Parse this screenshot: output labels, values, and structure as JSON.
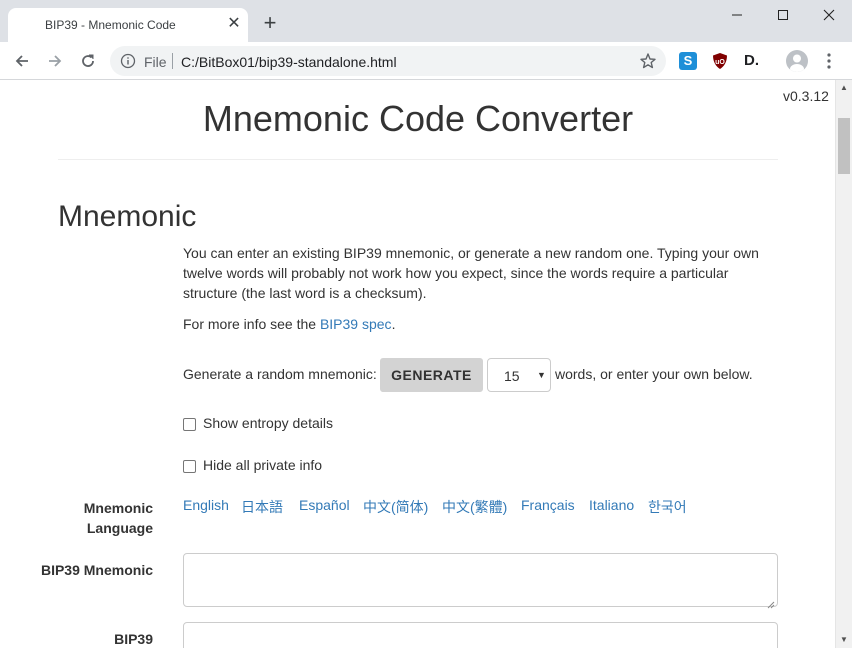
{
  "browser": {
    "tab_title": "BIP39 - Mnemonic Code",
    "omnibox_scheme": "File",
    "omnibox_url": "C:/BitBox01/bip39-standalone.html",
    "extensions": [
      "s-extension-icon",
      "ublock-icon",
      "d-extension-icon"
    ],
    "ext_s_label": "S",
    "ext_d_label": "D."
  },
  "page": {
    "version": "v0.3.12",
    "title": "Mnemonic Code Converter",
    "section_title": "Mnemonic",
    "intro_text": "You can enter an existing BIP39 mnemonic, or generate a new random one. Typing your own twelve words will probably not work how you expect, since the words require a particular structure (the last word is a checksum).",
    "moreinfo_prefix": "For more info see the ",
    "moreinfo_link": "BIP39 spec",
    "moreinfo_suffix": ".",
    "generate_label": "Generate a random mnemonic:",
    "generate_button": "GENERATE",
    "word_count_selected": "15",
    "generate_suffix": "words, or enter your own below.",
    "show_entropy_label": "Show entropy details",
    "hide_private_label": "Hide all private info",
    "language_label": "Mnemonic Language",
    "languages": [
      "English",
      "日本語",
      "Español",
      "中文(简体)",
      "中文(繁體)",
      "Français",
      "Italiano",
      "한국어"
    ],
    "bip39_mnemonic_label": "BIP39 Mnemonic",
    "bip39_mnemonic_value": "",
    "next_label": "BIP39"
  },
  "colors": {
    "link": "#337ab7",
    "button_bg": "#d3d3d3",
    "chrome_bg": "#dee1e6"
  }
}
